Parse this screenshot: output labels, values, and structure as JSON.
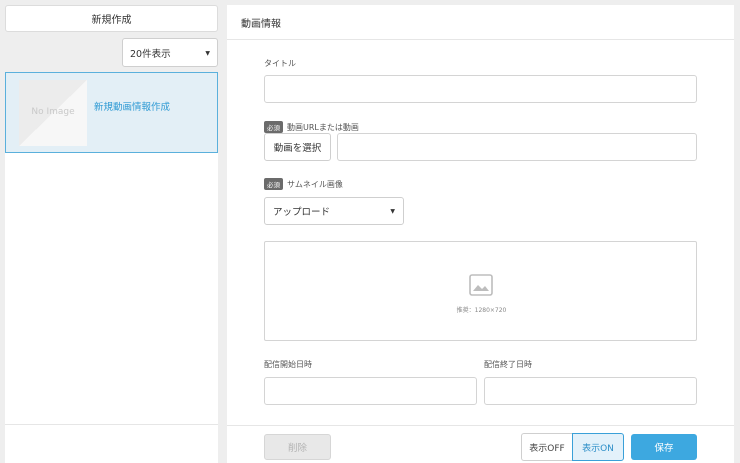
{
  "sidebar": {
    "new_button_label": "新規作成",
    "per_page_label": "20件表示",
    "items": [
      {
        "title": "新規動画情報作成",
        "thumbnail_text": "No Image"
      }
    ]
  },
  "panel": {
    "title": "動画情報",
    "title_field_label": "タイトル",
    "title_field_value": "",
    "required_badge": "必須",
    "video_label": "動画URLまたは動画",
    "video_select_button": "動画を選択",
    "video_url_value": "",
    "thumbnail_label": "サムネイル画像",
    "upload_select_value": "アップロード",
    "image_recommendation": "推奨：1280×720",
    "start_label": "配信開始日時",
    "end_label": "配信終了日時",
    "start_value": "",
    "end_value": ""
  },
  "footer": {
    "delete_label": "削除",
    "off_label": "表示OFF",
    "on_label": "表示ON",
    "save_label": "保存"
  },
  "colors": {
    "accent": "#3da8e0",
    "selected_bg": "#e3eff6",
    "link": "#2e9ad4"
  },
  "icons": [
    "caret-down-icon",
    "image-placeholder-icon"
  ]
}
